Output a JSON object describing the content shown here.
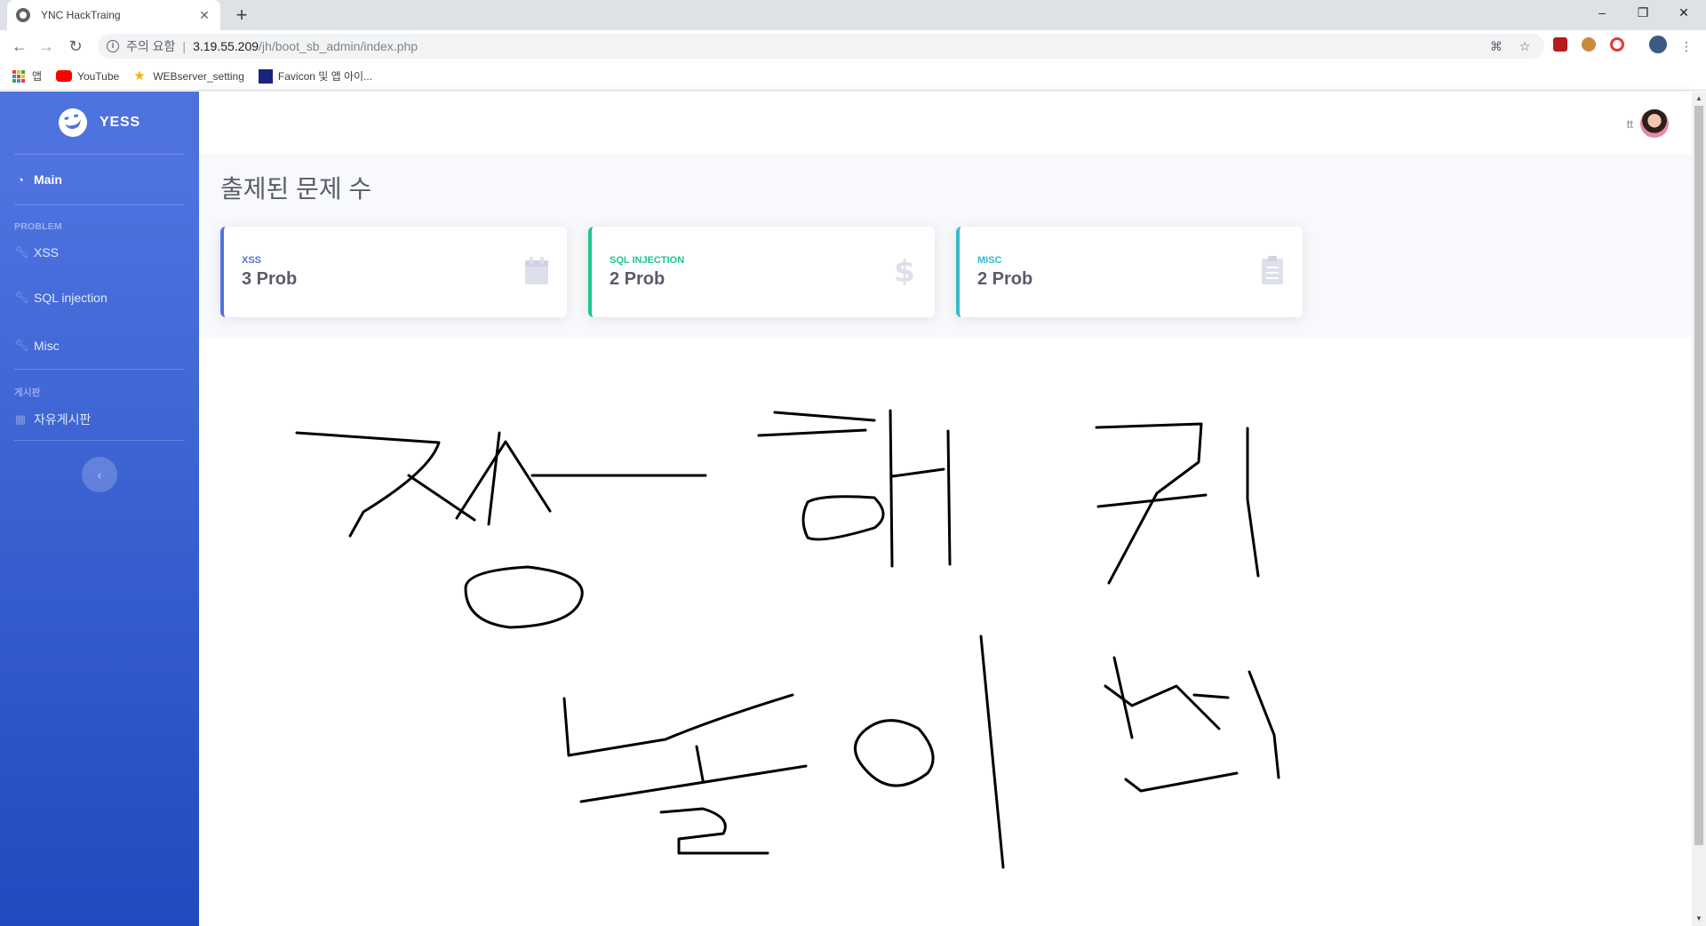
{
  "browser": {
    "tab_title": "YNC HackTraing",
    "url_warning": "주의 요함",
    "url_host": "3.19.55.209",
    "url_path": "/jh/boot_sb_admin/index.php",
    "bookmarks": [
      {
        "label": "앱",
        "icon": "apps-grid-icon"
      },
      {
        "label": "YouTube",
        "icon": "youtube-icon"
      },
      {
        "label": "WEBserver_setting",
        "icon": "star-icon"
      },
      {
        "label": "Favicon 및 앱 아이...",
        "icon": "favicon-icon"
      }
    ]
  },
  "sidebar": {
    "brand": "YESS",
    "main_label": "Main",
    "heading_problem": "PROBLEM",
    "items": [
      {
        "label": "XSS"
      },
      {
        "label": "SQL injection"
      },
      {
        "label": "Misc"
      }
    ],
    "heading_board": "게시판",
    "board_item": "자유게시판",
    "toggle_glyph": "‹"
  },
  "topbar": {
    "username": "tt"
  },
  "main": {
    "title": "출제된 문제 수",
    "cards": [
      {
        "label": "XSS",
        "value": "3 Prob",
        "color": "#4e73df",
        "icon": "calendar-icon"
      },
      {
        "label": "SQL INJECTION",
        "value": "2 Prob",
        "color": "#1cc88a",
        "icon": "dollar-icon"
      },
      {
        "label": "MISC",
        "value": "2 Prob",
        "color": "#36b9cc",
        "icon": "clipboard-icon"
      }
    ]
  }
}
